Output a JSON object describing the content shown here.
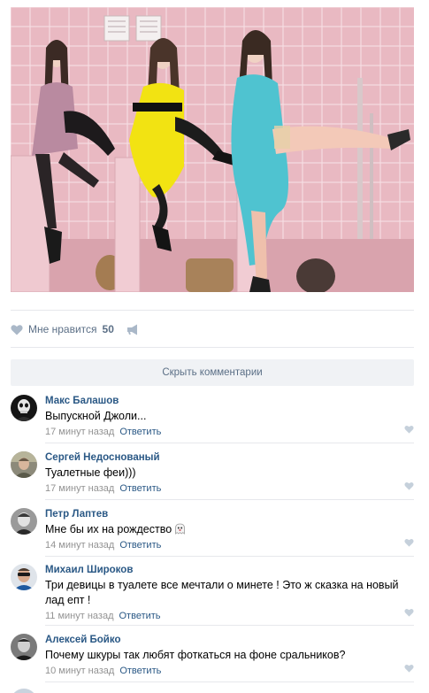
{
  "post": {
    "like_label": "Мне нравится",
    "like_count": "50"
  },
  "comments_toggle": "Скрыть комментарии",
  "comments": [
    {
      "author": "Макс Балашов",
      "text": "Выпускной Джоли...",
      "time": "17 минут назад",
      "reply": "Ответить"
    },
    {
      "author": "Сергей Недоснованый",
      "text": "Туалетные феи)))",
      "time": "17 минут назад",
      "reply": "Ответить"
    },
    {
      "author": "Петр Лаптев",
      "text": "Мне бы их на рождество",
      "time": "14 минут назад",
      "reply": "Ответить"
    },
    {
      "author": "Михаил Широков",
      "text": "Три девицы в туалете все мечтали о минете ! Это ж сказка на новый лад епт !",
      "time": "11 минут назад",
      "reply": "Ответить"
    },
    {
      "author": "Алексей Бойко",
      "text": "Почему шкуры так любят фоткаться на фоне сральников?",
      "time": "10 минут назад",
      "reply": "Ответить"
    }
  ],
  "colors": {
    "link": "#2a5885",
    "muted": "#939393",
    "action": "#5b6f86",
    "button_bg": "#f0f2f5"
  }
}
